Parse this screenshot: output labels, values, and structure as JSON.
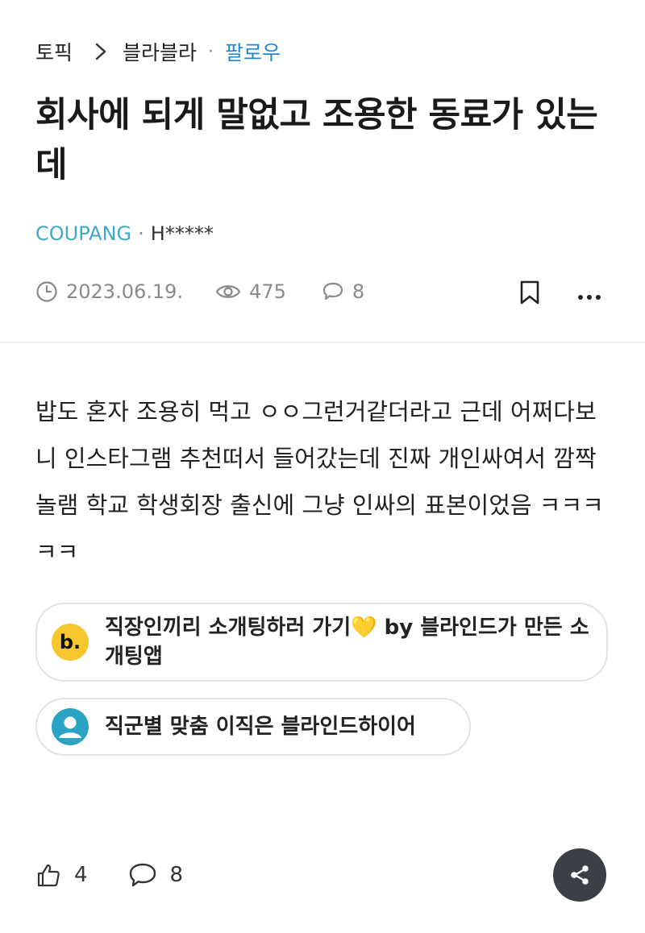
{
  "breadcrumb": {
    "topic": "토픽",
    "board": "블라블라",
    "dot": "·",
    "follow": "팔로우"
  },
  "post": {
    "title": "회사에 되게 말없고 조용한 동료가 있는데",
    "company": "COUPANG",
    "separator": "·",
    "author": "H*****",
    "date": "2023.06.19.",
    "views": "475",
    "comments": "8",
    "body": "밥도 혼자 조용히 먹고 ㅇㅇ그런거같더라고 근데 어쩌다보니 인스타그램 추천떠서 들어갔는데 진짜 개인싸여서 깜짝놀램 학교 학생회장 출신에 그냥 인싸의 표본이었음 ㅋㅋㅋㅋㅋ"
  },
  "ads": [
    {
      "logo": "b.",
      "text": "직장인끼리 소개팅하러 가기",
      "emoji": "💛",
      "suffix": " by 블라인드가 만든 소개팅앱",
      "icon": "blind-dating-logo-icon"
    },
    {
      "text": "직군별 맞춤 이직은 블라인드하이어",
      "icon": "person-avatar-icon"
    }
  ],
  "footer": {
    "likes": "4",
    "comments": "8"
  },
  "colors": {
    "follow": "#1e88d4",
    "company": "#3fa9c8",
    "share_bg": "#3b3f46"
  }
}
